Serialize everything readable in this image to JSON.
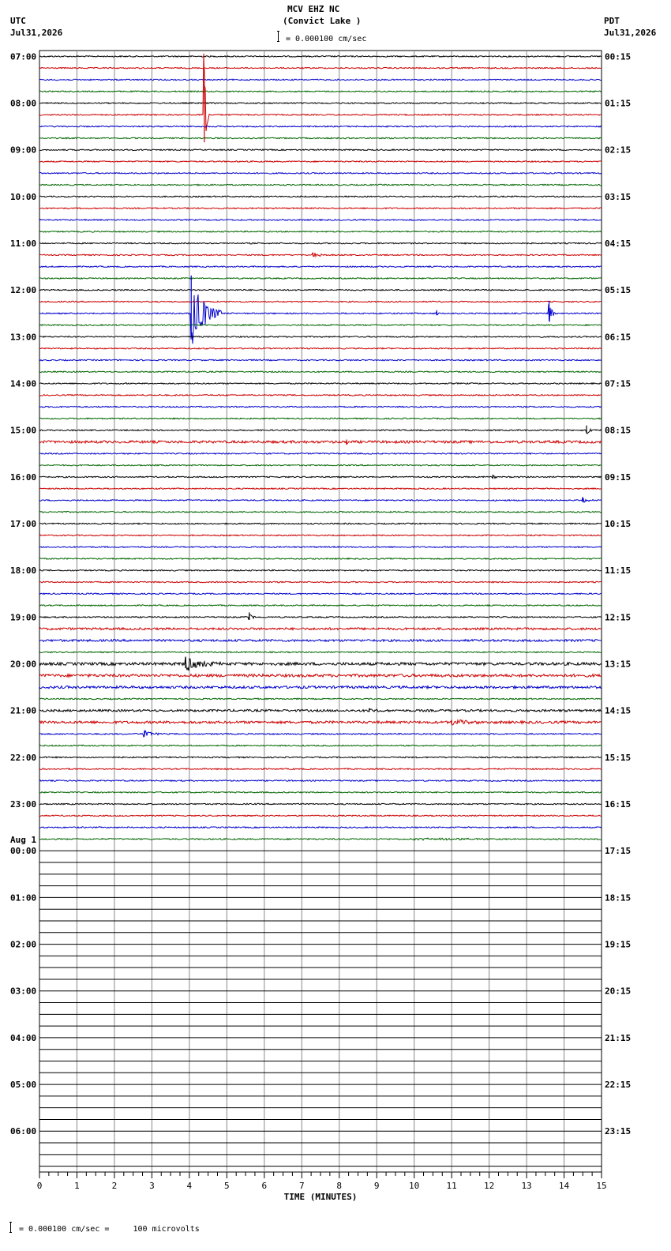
{
  "header": {
    "station": "MCV EHZ NC",
    "location": "(Convict Lake )",
    "scale_text": "= 0.000100 cm/sec",
    "left_tz": "UTC",
    "left_date": "Jul31,2026",
    "right_tz": "PDT",
    "right_date": "Jul31,2026"
  },
  "footer": {
    "scale_text": "= 0.000100 cm/sec =     100 microvolts"
  },
  "chart_data": {
    "type": "line",
    "title": "MCV EHZ NC (Convict Lake )",
    "xlabel": "TIME (MINUTES)",
    "xlim": [
      0,
      15
    ],
    "x_ticks": [
      "0",
      "1",
      "2",
      "3",
      "4",
      "5",
      "6",
      "7",
      "8",
      "9",
      "10",
      "11",
      "12",
      "13",
      "14",
      "15"
    ],
    "rows_per_hour": 4,
    "total_rows": 96,
    "recorded_rows": 68,
    "trace_colors": [
      "#000000",
      "#cc0000",
      "#0000cc",
      "#006600"
    ],
    "grid": true,
    "left_labels": [
      {
        "row": 0,
        "text": "07:00"
      },
      {
        "row": 4,
        "text": "08:00"
      },
      {
        "row": 8,
        "text": "09:00"
      },
      {
        "row": 12,
        "text": "10:00"
      },
      {
        "row": 16,
        "text": "11:00"
      },
      {
        "row": 20,
        "text": "12:00"
      },
      {
        "row": 24,
        "text": "13:00"
      },
      {
        "row": 28,
        "text": "14:00"
      },
      {
        "row": 32,
        "text": "15:00"
      },
      {
        "row": 36,
        "text": "16:00"
      },
      {
        "row": 40,
        "text": "17:00"
      },
      {
        "row": 44,
        "text": "18:00"
      },
      {
        "row": 48,
        "text": "19:00"
      },
      {
        "row": 52,
        "text": "20:00"
      },
      {
        "row": 56,
        "text": "21:00"
      },
      {
        "row": 60,
        "text": "22:00"
      },
      {
        "row": 64,
        "text": "23:00"
      },
      {
        "row": 68,
        "text": "00:00"
      },
      {
        "row": 72,
        "text": "01:00"
      },
      {
        "row": 76,
        "text": "02:00"
      },
      {
        "row": 80,
        "text": "03:00"
      },
      {
        "row": 84,
        "text": "04:00"
      },
      {
        "row": 88,
        "text": "05:00"
      },
      {
        "row": 92,
        "text": "06:00"
      }
    ],
    "date_change_label": {
      "row": 68,
      "text": "Aug 1"
    },
    "right_labels": [
      {
        "row": 0,
        "text": "00:15"
      },
      {
        "row": 4,
        "text": "01:15"
      },
      {
        "row": 8,
        "text": "02:15"
      },
      {
        "row": 12,
        "text": "03:15"
      },
      {
        "row": 16,
        "text": "04:15"
      },
      {
        "row": 20,
        "text": "05:15"
      },
      {
        "row": 24,
        "text": "06:15"
      },
      {
        "row": 28,
        "text": "07:15"
      },
      {
        "row": 32,
        "text": "08:15"
      },
      {
        "row": 36,
        "text": "09:15"
      },
      {
        "row": 40,
        "text": "10:15"
      },
      {
        "row": 44,
        "text": "11:15"
      },
      {
        "row": 48,
        "text": "12:15"
      },
      {
        "row": 52,
        "text": "13:15"
      },
      {
        "row": 56,
        "text": "14:15"
      },
      {
        "row": 60,
        "text": "15:15"
      },
      {
        "row": 64,
        "text": "16:15"
      },
      {
        "row": 68,
        "text": "17:15"
      },
      {
        "row": 72,
        "text": "18:15"
      },
      {
        "row": 76,
        "text": "19:15"
      },
      {
        "row": 80,
        "text": "20:15"
      },
      {
        "row": 84,
        "text": "21:15"
      },
      {
        "row": 88,
        "text": "22:15"
      },
      {
        "row": 92,
        "text": "23:15"
      }
    ],
    "noisy_rows": [
      {
        "row": 33,
        "amp": 1.6
      },
      {
        "row": 49,
        "amp": 1.4
      },
      {
        "row": 50,
        "amp": 1.4
      },
      {
        "row": 52,
        "amp": 1.8
      },
      {
        "row": 53,
        "amp": 1.8
      },
      {
        "row": 54,
        "amp": 1.6
      },
      {
        "row": 56,
        "amp": 1.4
      },
      {
        "row": 57,
        "amp": 1.6
      }
    ],
    "events": [
      {
        "row": 5,
        "minute": 4.4,
        "amp": 58,
        "duration": 0.12
      },
      {
        "row": 22,
        "minute": 4.05,
        "amp": 48,
        "duration": 0.8
      },
      {
        "row": 22,
        "minute": 13.6,
        "amp": 16,
        "duration": 0.15
      },
      {
        "row": 22,
        "minute": 10.6,
        "amp": 4,
        "duration": 0.05
      },
      {
        "row": 17,
        "minute": 7.3,
        "amp": 3,
        "duration": 0.4
      },
      {
        "row": 32,
        "minute": 14.6,
        "amp": 6,
        "duration": 0.2
      },
      {
        "row": 33,
        "minute": 8.2,
        "amp": 3,
        "duration": 0.1
      },
      {
        "row": 36,
        "minute": 12.1,
        "amp": 3,
        "duration": 0.2
      },
      {
        "row": 38,
        "minute": 14.5,
        "amp": 4,
        "duration": 0.3
      },
      {
        "row": 48,
        "minute": 5.6,
        "amp": 6,
        "duration": 0.2
      },
      {
        "row": 52,
        "minute": 3.9,
        "amp": 9,
        "duration": 1.0
      },
      {
        "row": 56,
        "minute": 8.8,
        "amp": 3,
        "duration": 0.3
      },
      {
        "row": 57,
        "minute": 11.0,
        "amp": 3,
        "duration": 1.2
      },
      {
        "row": 58,
        "minute": 2.8,
        "amp": 4,
        "duration": 0.6
      },
      {
        "row": 67,
        "minute": 10.0,
        "amp": 1,
        "duration": 5.0
      }
    ]
  }
}
